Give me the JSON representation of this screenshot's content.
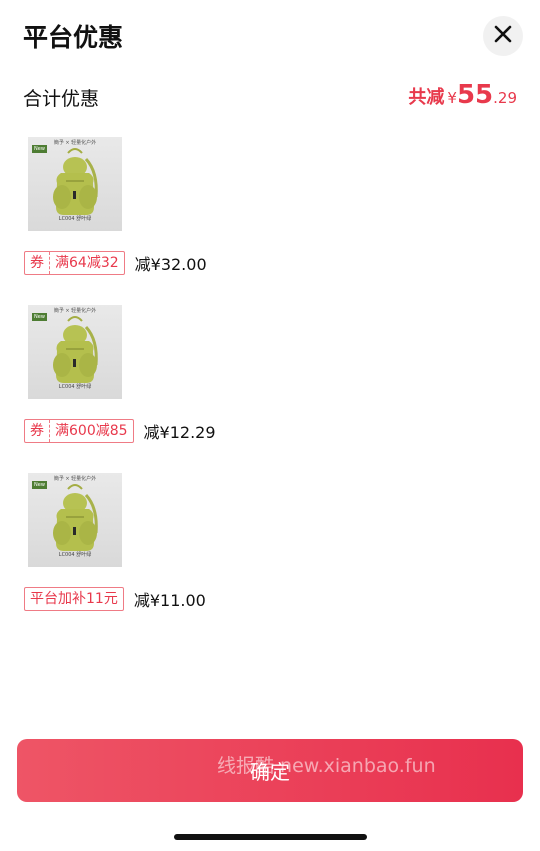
{
  "header": {
    "title": "平台优惠",
    "close_icon": "close-icon"
  },
  "summary": {
    "label": "合计优惠",
    "prefix": "共减",
    "currency": "¥",
    "amount_int": "55",
    "amount_dec": ".29",
    "color": "#e8394c"
  },
  "items": [
    {
      "product": {
        "brand": "簡予 × 轻量化户外",
        "caption": "LC004 舒叶绿",
        "badge": "New"
      },
      "tag_a": "券",
      "tag_b": "满64减32",
      "reduce": "减¥32.00"
    },
    {
      "product": {
        "brand": "簡予 × 轻量化户外",
        "caption": "LC004 舒叶绿",
        "badge": "New"
      },
      "tag_a": "券",
      "tag_b": "满600减85",
      "reduce": "减¥12.29"
    },
    {
      "product": {
        "brand": "簡予 × 轻量化户外",
        "caption": "LC004 舒叶绿",
        "badge": "New"
      },
      "tag_b": "平台加补11元",
      "reduce": "减¥11.00"
    }
  ],
  "footer": {
    "confirm_label": "确定",
    "watermark": "线报酷 new.xianbao.fun"
  }
}
